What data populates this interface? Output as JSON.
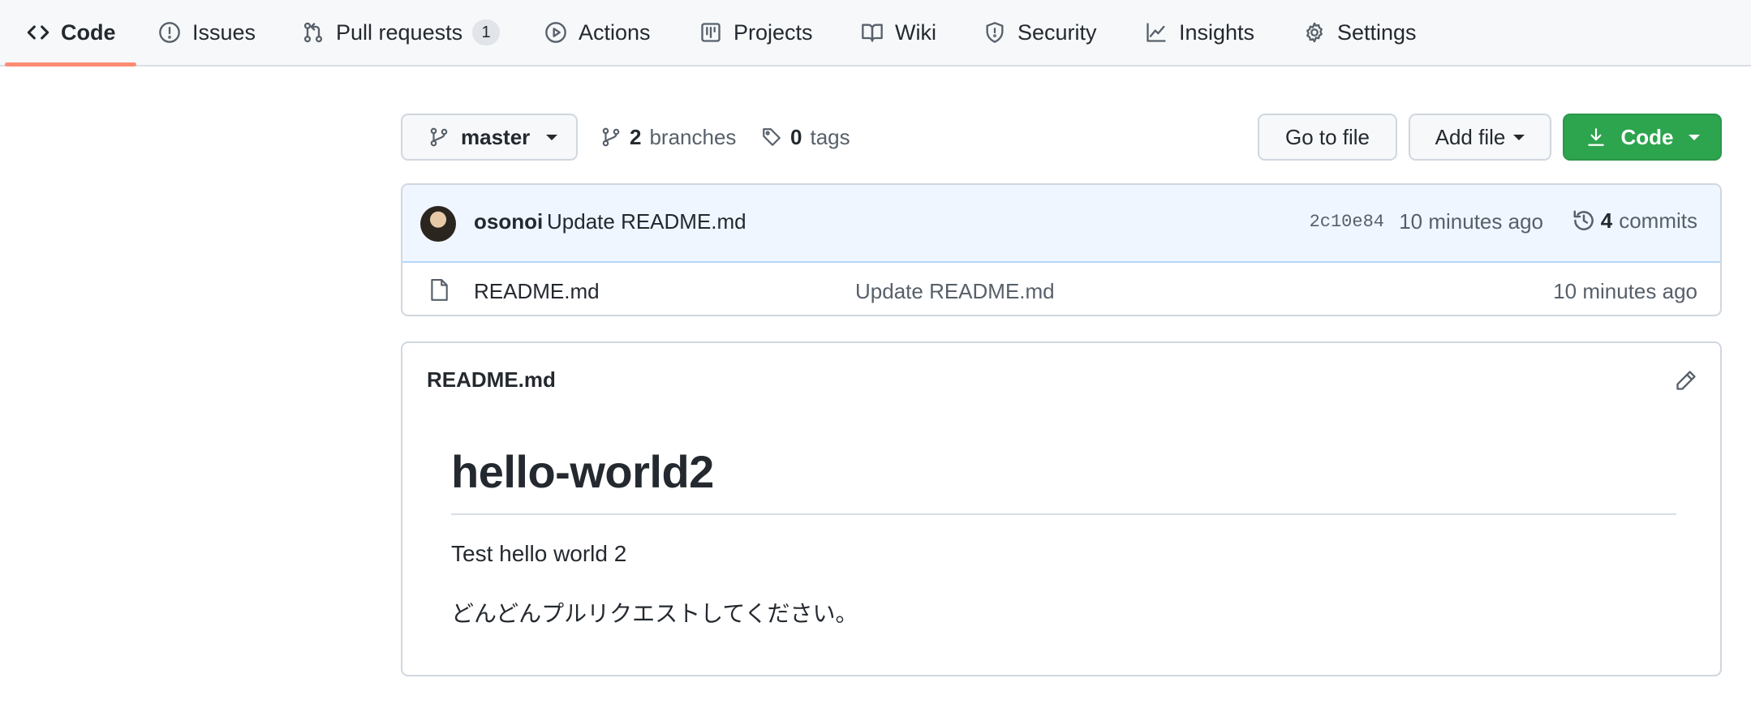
{
  "nav": {
    "tabs": [
      {
        "label": "Code",
        "icon": "code-icon",
        "selected": true
      },
      {
        "label": "Issues",
        "icon": "issue-icon"
      },
      {
        "label": "Pull requests",
        "icon": "pull-request-icon",
        "counter": "1"
      },
      {
        "label": "Actions",
        "icon": "play-icon"
      },
      {
        "label": "Projects",
        "icon": "project-icon"
      },
      {
        "label": "Wiki",
        "icon": "book-icon"
      },
      {
        "label": "Security",
        "icon": "shield-icon"
      },
      {
        "label": "Insights",
        "icon": "graph-icon"
      },
      {
        "label": "Settings",
        "icon": "gear-icon"
      }
    ]
  },
  "toolbar": {
    "branch": "master",
    "branches_count": "2",
    "branches_label": "branches",
    "tags_count": "0",
    "tags_label": "tags",
    "go_to_file": "Go to file",
    "add_file": "Add file",
    "code": "Code"
  },
  "latest_commit": {
    "author": "osonoi",
    "message": "Update README.md",
    "sha": "2c10e84",
    "time": "10 minutes ago",
    "commits_count": "4",
    "commits_label": "commits"
  },
  "files": [
    {
      "name": "README.md",
      "commit_message": "Update README.md",
      "time": "10 minutes ago",
      "icon": "file-icon"
    }
  ],
  "readme": {
    "filename": "README.md",
    "heading": "hello-world2",
    "paragraphs": [
      "Test hello world 2",
      "どんどんプルリクエストしてください。"
    ]
  },
  "colors": {
    "accent_underline": "#fd8c73",
    "code_button": "#2da44e",
    "commit_bar": "#eff6ff"
  }
}
